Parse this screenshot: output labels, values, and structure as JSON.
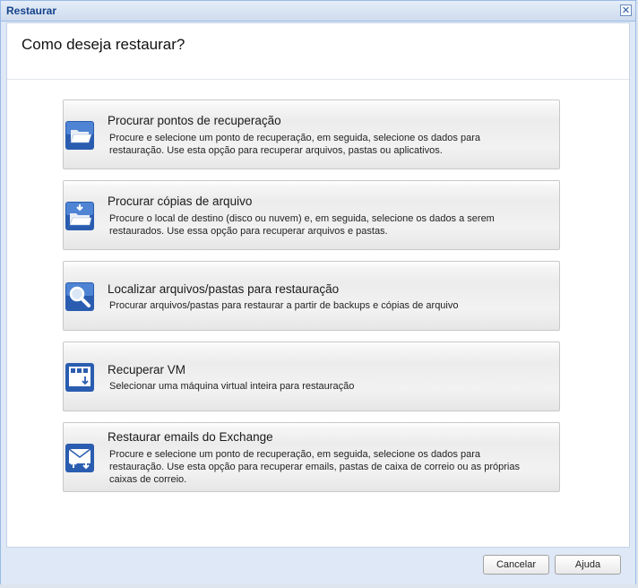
{
  "window": {
    "title": "Restaurar",
    "close_glyph": "✕"
  },
  "heading": "Como deseja restaurar?",
  "options": [
    {
      "title": "Procurar pontos de recuperação",
      "desc": "Procure e selecione um ponto de recuperação, em seguida, selecione os dados para restauração. Use esta opção para recuperar arquivos, pastas ou aplicativos.",
      "icon": "folder-open-icon"
    },
    {
      "title": "Procurar cópias de arquivo",
      "desc": "Procure o local de destino (disco ou nuvem) e, em seguida, selecione os dados a serem restaurados. Use essa opção para recuperar arquivos e pastas.",
      "icon": "folder-copy-icon"
    },
    {
      "title": "Localizar arquivos/pastas para restauração",
      "desc": "Procurar arquivos/pastas para restaurar a partir de backups e cópias de arquivo",
      "icon": "search-icon"
    },
    {
      "title": "Recuperar VM",
      "desc": "Selecionar uma máquina virtual inteira para restauração",
      "icon": "vm-icon"
    },
    {
      "title": "Restaurar emails do Exchange",
      "desc": "Procure e selecione um ponto de recuperação, em seguida, selecione os dados para restauração. Use esta opção para recuperar emails, pastas de caixa de correio ou as próprias caixas de correio.",
      "icon": "exchange-mail-icon"
    }
  ],
  "footer": {
    "cancel_label": "Cancelar",
    "help_label": "Ajuda"
  },
  "colors": {
    "title_text": "#15428b",
    "icon_blue": "#2a5db0",
    "footer_bg": "#dfe8f6"
  }
}
